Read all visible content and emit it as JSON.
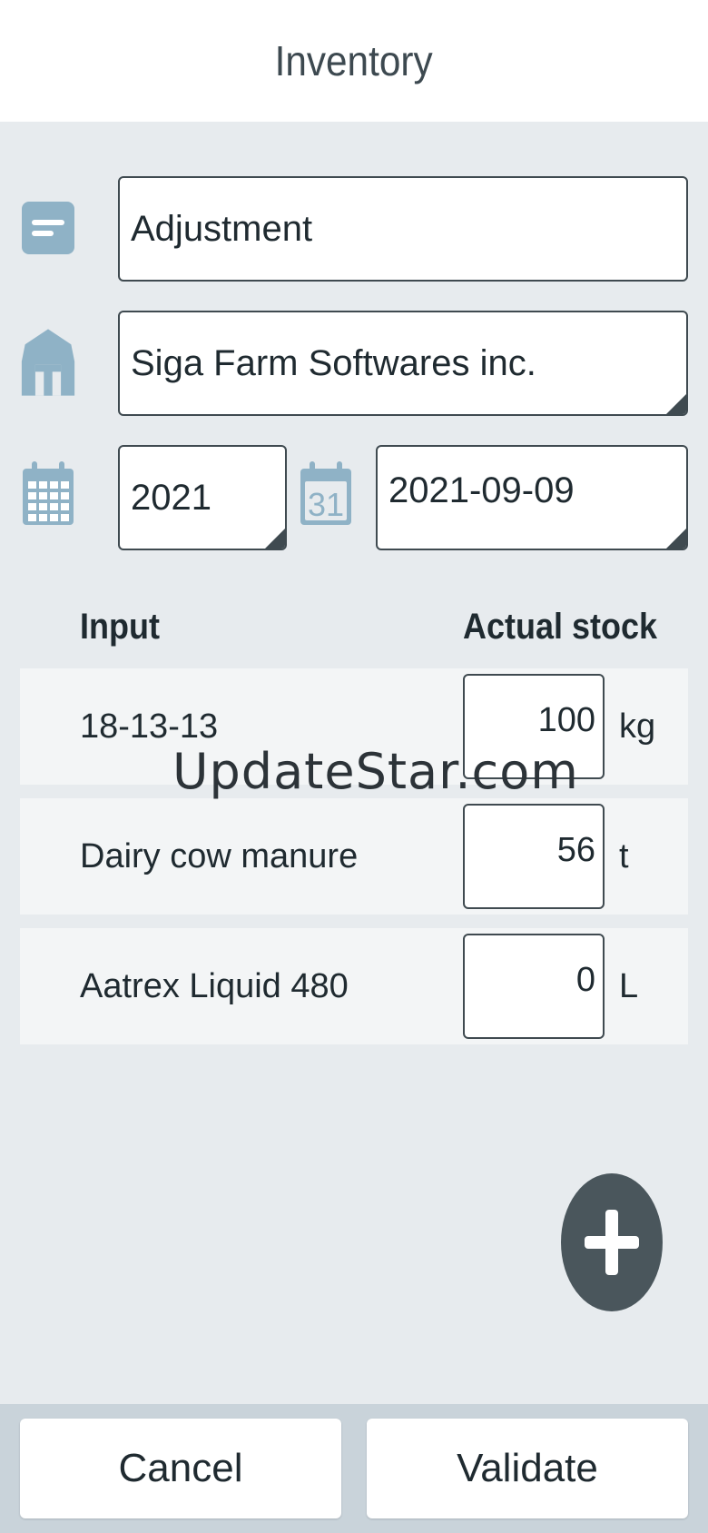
{
  "header": {
    "title": "Inventory"
  },
  "form": {
    "type_value": "Adjustment",
    "farm_value": "Siga Farm Softwares inc.",
    "year_value": "2021",
    "date_value": "2021-09-09",
    "calendar_day_label": "31"
  },
  "table": {
    "col_input": "Input",
    "col_stock": "Actual stock",
    "rows": [
      {
        "name": "18-13-13",
        "qty": "100",
        "unit": "kg"
      },
      {
        "name": "Dairy cow manure",
        "qty": "56",
        "unit": "t"
      },
      {
        "name": "Aatrex Liquid 480",
        "qty": "0",
        "unit": "L"
      }
    ]
  },
  "watermark": "UpdateStar.com",
  "actions": {
    "cancel_label": "Cancel",
    "validate_label": "Validate"
  },
  "icons": {
    "type": "note-icon",
    "farm": "barn-icon",
    "year": "calendar-grid-icon",
    "date": "calendar-day-icon",
    "add": "plus-icon"
  },
  "colors": {
    "icon": "#8fb2c6",
    "fab": "#4a565c",
    "border": "#3f4a50"
  }
}
